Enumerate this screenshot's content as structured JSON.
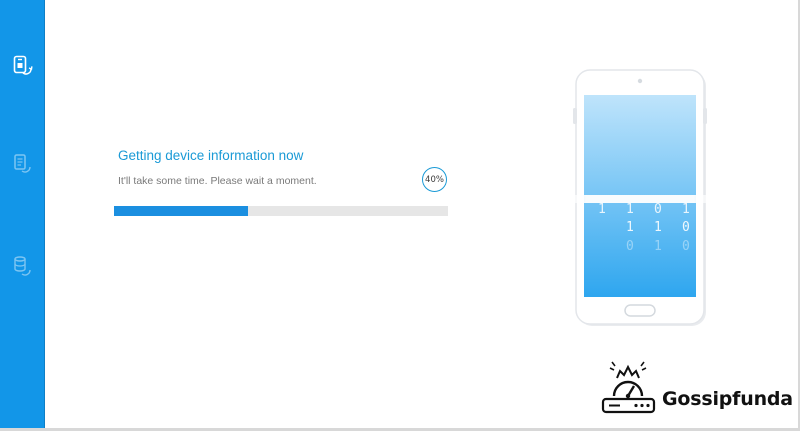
{
  "status": {
    "title": "Getting device information now",
    "subtitle": "It'll take some time. Please wait a moment.",
    "percent_label": "40%",
    "progress_fraction": 0.4
  },
  "sidebar": {
    "items": [
      {
        "icon": "phone-transfer-icon",
        "active": true
      },
      {
        "icon": "message-sync-icon",
        "active": false
      },
      {
        "icon": "database-sync-icon",
        "active": false
      }
    ]
  },
  "phone": {
    "binary_rows": [
      [
        "1",
        "1",
        "0",
        "1"
      ],
      [
        "1",
        "1",
        "0"
      ],
      [
        "0",
        "1",
        "0"
      ]
    ]
  },
  "watermark": {
    "text": "Gossipfunda",
    "icon": "speedometer-router-icon"
  },
  "colors": {
    "accent": "#1296e8",
    "title_text": "#1a9ad6",
    "progress_fill": "#1b8fe0",
    "progress_track": "#e6e6e6",
    "screen_top": "#bfe4fb",
    "screen_bottom": "#2ea6ef"
  }
}
